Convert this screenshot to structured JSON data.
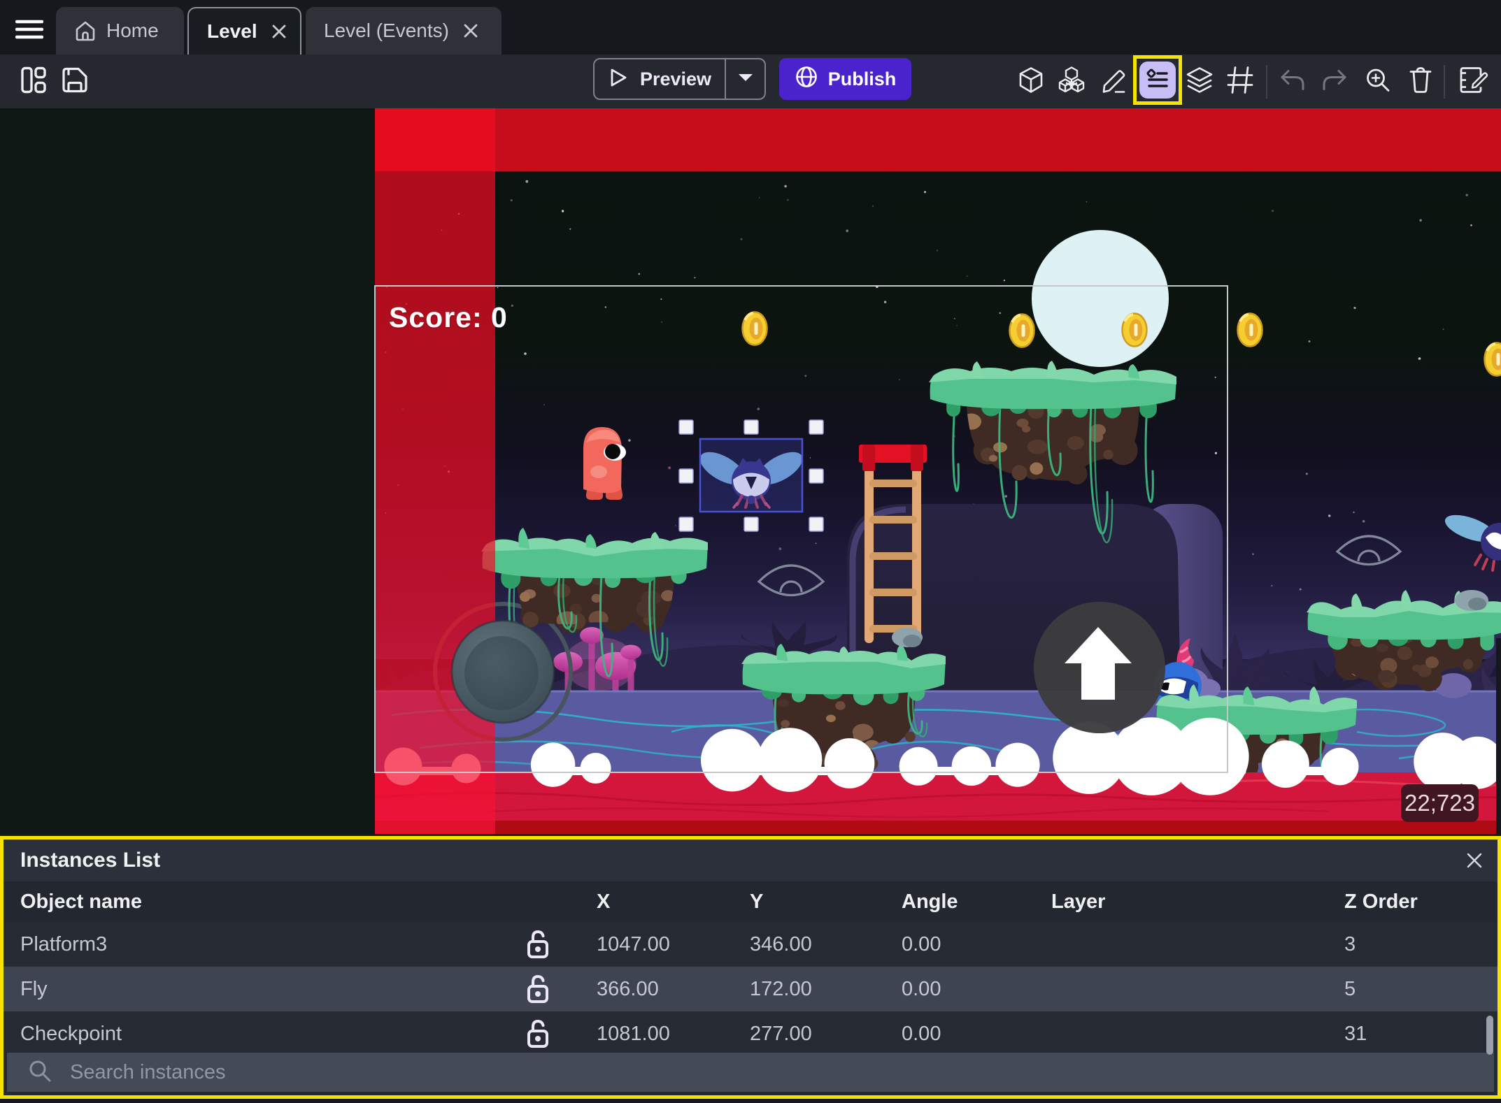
{
  "window": {
    "menu_icon": "hamburger-icon"
  },
  "tabs": [
    {
      "label": "Home",
      "icon": "home-icon",
      "active": false,
      "closable": false
    },
    {
      "label": "Level",
      "active": true,
      "closable": true
    },
    {
      "label": "Level (Events)",
      "active": false,
      "closable": true
    }
  ],
  "toolbar": {
    "preview_label": "Preview",
    "publish_label": "Publish",
    "icons": [
      "project-manager-icon",
      "save-icon",
      "view-3d-icon",
      "objects-icon",
      "paint-brush-icon",
      "instances-list-icon",
      "layers-icon",
      "grid-icon",
      "undo-icon",
      "redo-icon",
      "zoom-in-icon",
      "trash-icon",
      "edit-properties-icon"
    ],
    "highlight_color": "#f6e300",
    "publish_color": "#4a23cd",
    "instances_icon_bg": "#c9bdf6"
  },
  "scene": {
    "score_label": "Score: 0",
    "coords_badge": "22;723"
  },
  "panel": {
    "title": "Instances List",
    "close_icon": "close-icon",
    "search_placeholder": "Search instances",
    "columns": [
      "Object name",
      "X",
      "Y",
      "Angle",
      "Layer",
      "Z Order"
    ],
    "rows": [
      {
        "name": "Platform3",
        "x": "1047.00",
        "y": "346.00",
        "angle": "0.00",
        "layer": "",
        "z": "3"
      },
      {
        "name": "Fly",
        "x": "366.00",
        "y": "172.00",
        "angle": "0.00",
        "layer": "",
        "z": "5"
      },
      {
        "name": "Checkpoint",
        "x": "1081.00",
        "y": "277.00",
        "angle": "0.00",
        "layer": "",
        "z": "31"
      }
    ],
    "highlight_color": "#f6e300"
  }
}
